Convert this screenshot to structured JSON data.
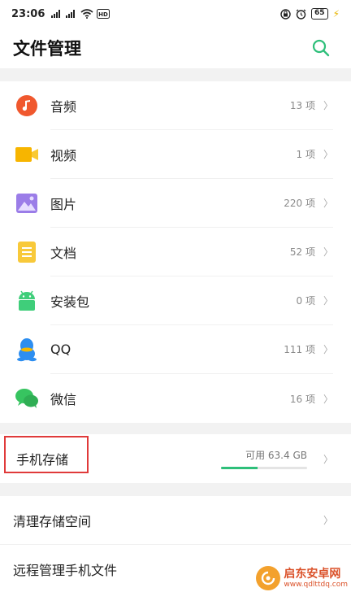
{
  "status_bar": {
    "time": "23:06",
    "signal": "4G  4G",
    "battery": "65"
  },
  "header": {
    "title": "文件管理",
    "search_icon": "search-icon",
    "accent": "#2ebf7a"
  },
  "categories": [
    {
      "label": "音频",
      "count": "13 项",
      "icon": "music-icon",
      "color": "#f0582e"
    },
    {
      "label": "视频",
      "count": "1 项",
      "icon": "video-icon",
      "color": "#f7b500"
    },
    {
      "label": "图片",
      "count": "220 项",
      "icon": "image-icon",
      "color": "#9b7de8"
    },
    {
      "label": "文档",
      "count": "52 项",
      "icon": "document-icon",
      "color": "#f8c93a"
    },
    {
      "label": "安装包",
      "count": "0 项",
      "icon": "android-icon",
      "color": "#3fce7a"
    },
    {
      "label": "QQ",
      "count": "111 项",
      "icon": "qq-icon",
      "color": "#2d8ef0"
    },
    {
      "label": "微信",
      "count": "16 项",
      "icon": "wechat-icon",
      "color": "#37c460"
    }
  ],
  "storage": {
    "label": "手机存储",
    "free": "可用 63.4 GB",
    "used_fraction": 0.42
  },
  "tools": [
    {
      "label": "清理存储空间"
    },
    {
      "label": "远程管理手机文件"
    }
  ],
  "watermark": {
    "title": "启东安卓网",
    "url": "www.qdlttdq.com"
  },
  "chevron": "〉"
}
